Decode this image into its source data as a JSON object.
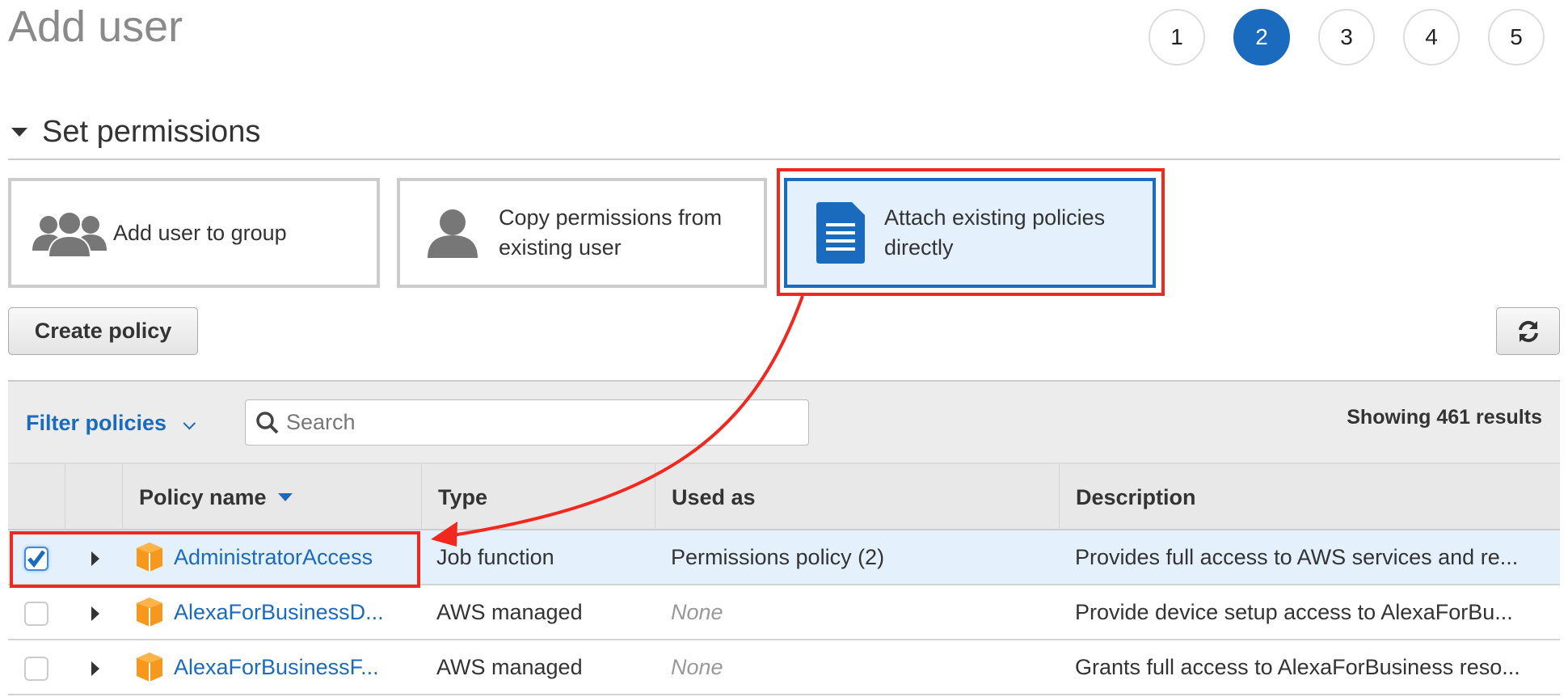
{
  "header": {
    "title": "Add user",
    "steps": [
      "1",
      "2",
      "3",
      "4",
      "5"
    ],
    "active_step": "2"
  },
  "section": {
    "title": "Set permissions"
  },
  "options": [
    {
      "label": "Add user to group",
      "icon": "group-icon"
    },
    {
      "label": "Copy permissions from existing user",
      "icon": "user-icon"
    },
    {
      "label": "Attach existing policies directly",
      "icon": "document-icon",
      "selected": true
    }
  ],
  "toolbar": {
    "create_policy": "Create policy",
    "refresh_icon": "refresh-icon"
  },
  "filter": {
    "label": "Filter policies",
    "search_placeholder": "Search",
    "results": "Showing 461 results"
  },
  "table": {
    "columns": [
      "Policy name",
      "Type",
      "Used as",
      "Description"
    ],
    "rows": [
      {
        "checked": true,
        "name": "AdministratorAccess",
        "type": "Job function",
        "used_as": "Permissions policy (2)",
        "description": "Provides full access to AWS services and re..."
      },
      {
        "checked": false,
        "name": "AlexaForBusinessD...",
        "type": "AWS managed",
        "used_as": "None",
        "description": "Provide device setup access to AlexaForBu..."
      },
      {
        "checked": false,
        "name": "AlexaForBusinessF...",
        "type": "AWS managed",
        "used_as": "None",
        "description": "Grants full access to AlexaForBusiness reso..."
      }
    ]
  },
  "colors": {
    "accent": "#1a6bbd",
    "annotation": "#f0281e",
    "policy_icon": "#f7981d"
  }
}
